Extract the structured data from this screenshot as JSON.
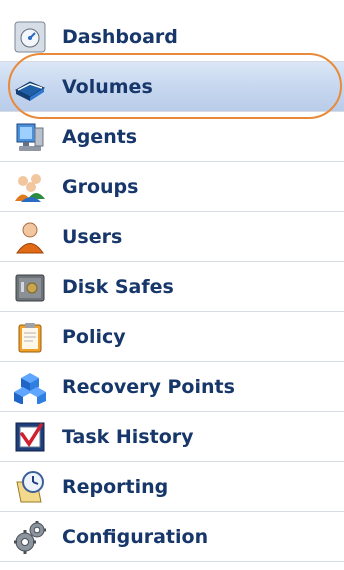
{
  "nav": {
    "items": [
      {
        "label": "Dashboard",
        "icon": "dashboard-icon"
      },
      {
        "label": "Volumes",
        "icon": "volumes-icon",
        "selected": true
      },
      {
        "label": "Agents",
        "icon": "agents-icon"
      },
      {
        "label": "Groups",
        "icon": "groups-icon"
      },
      {
        "label": "Users",
        "icon": "users-icon"
      },
      {
        "label": "Disk Safes",
        "icon": "disk-safes-icon"
      },
      {
        "label": "Policy",
        "icon": "policy-icon"
      },
      {
        "label": "Recovery Points",
        "icon": "recovery-points-icon"
      },
      {
        "label": "Task History",
        "icon": "task-history-icon"
      },
      {
        "label": "Reporting",
        "icon": "reporting-icon"
      },
      {
        "label": "Configuration",
        "icon": "configuration-icon"
      }
    ]
  },
  "colors": {
    "label": "#17376a",
    "highlight": "#e98a3b",
    "selected_bg": "#c7d7ef",
    "divider": "#d7dce4"
  }
}
